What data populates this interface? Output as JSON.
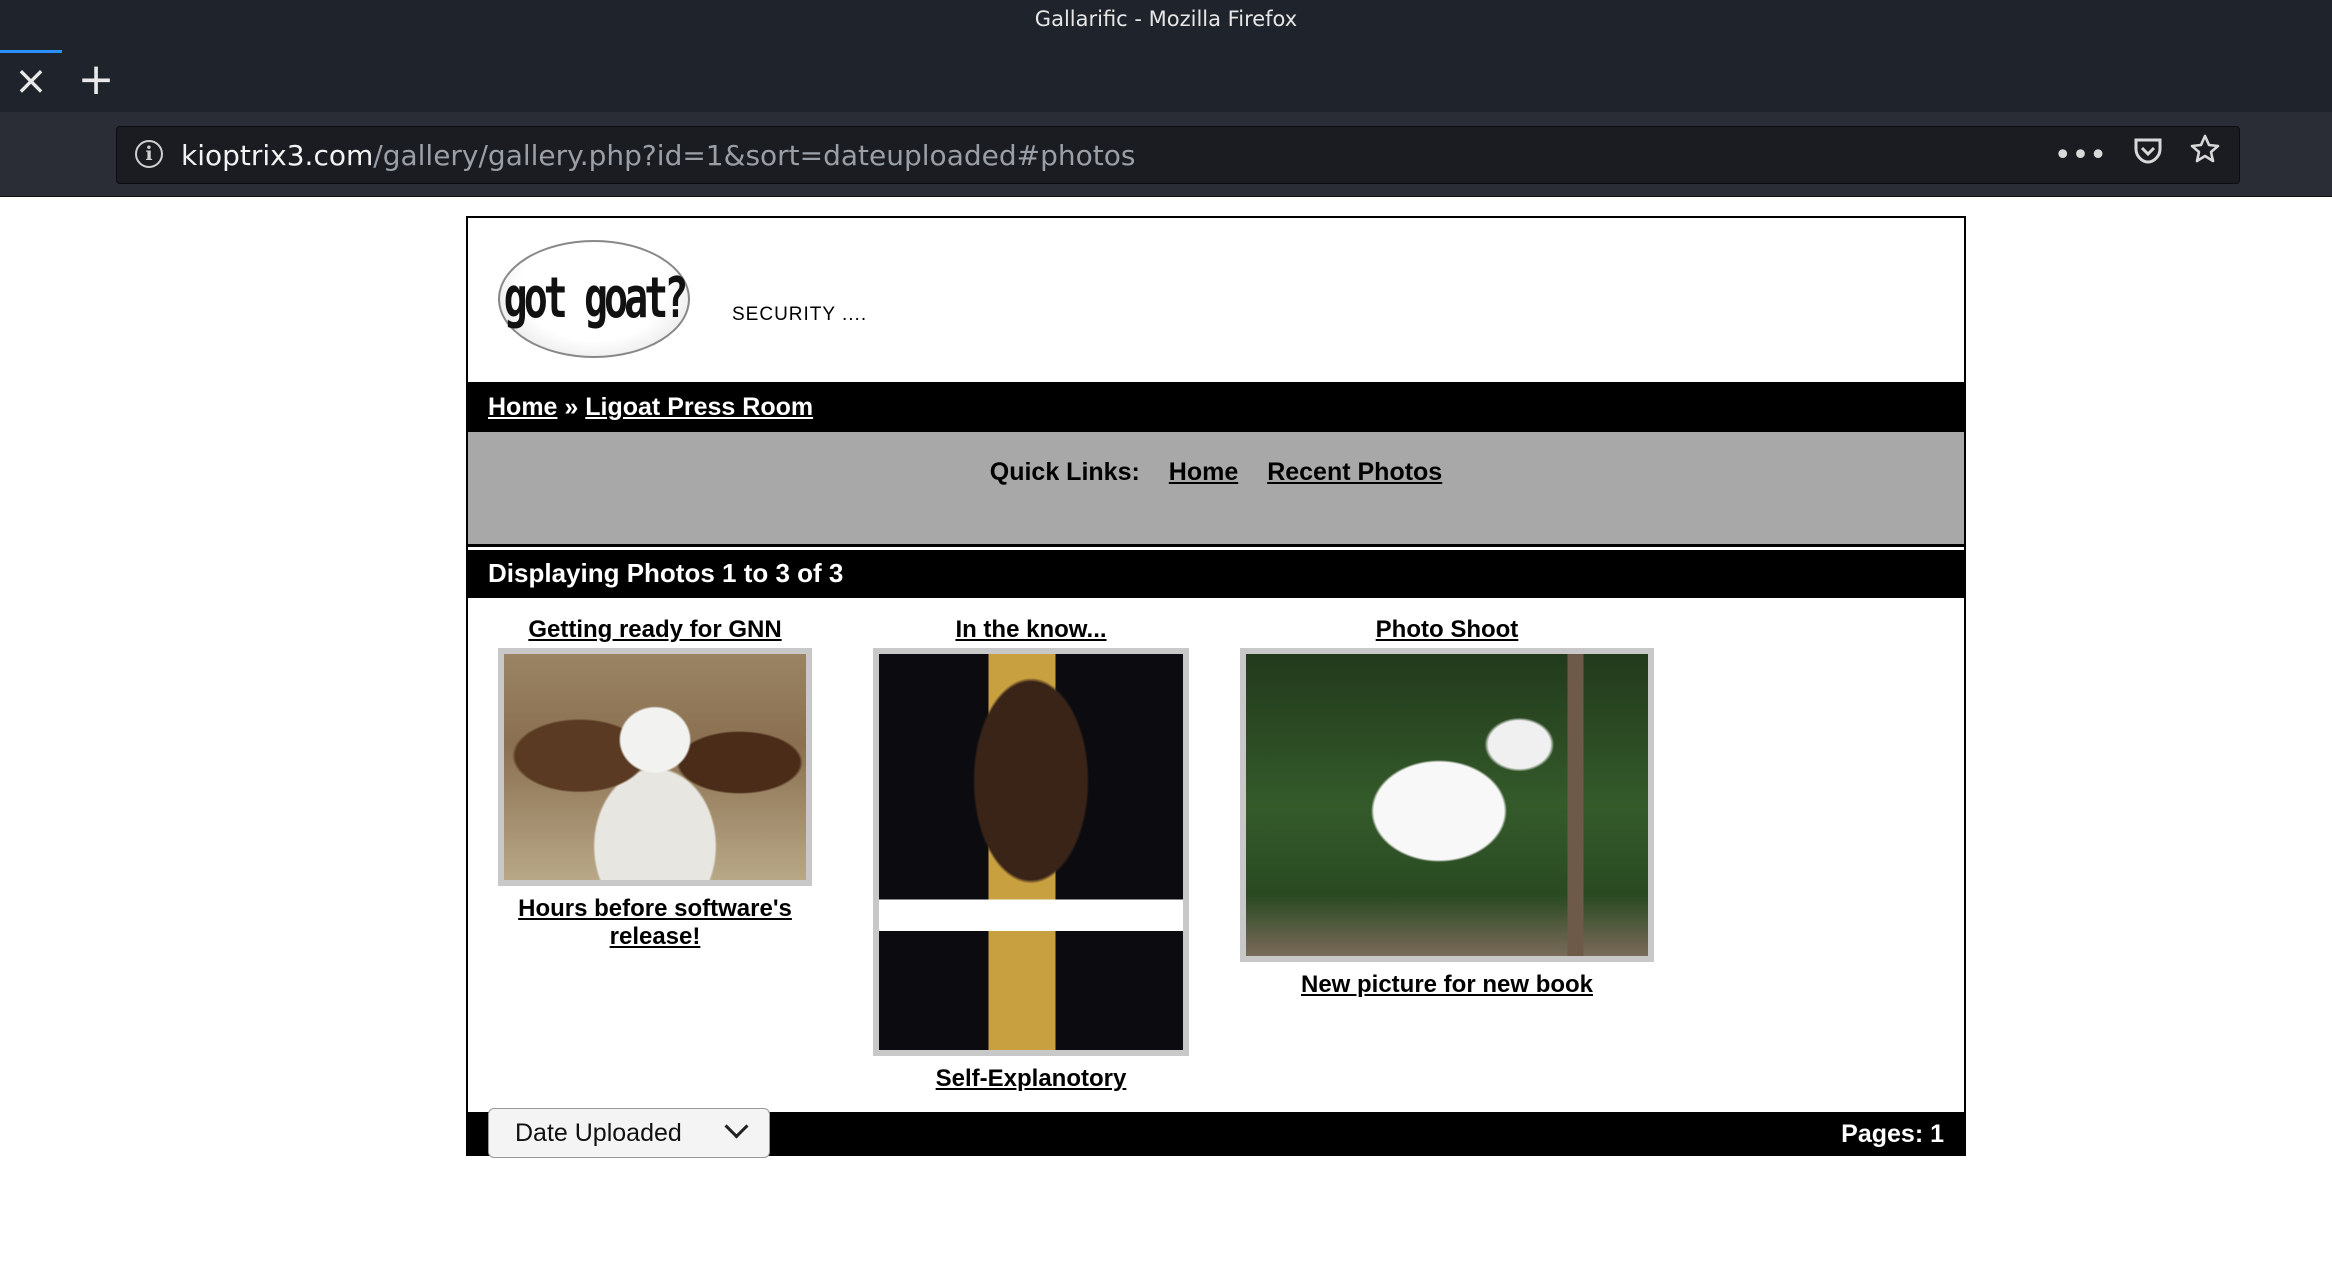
{
  "browser": {
    "window_title": "Gallarific - Mozilla Firefox",
    "tab_close_glyph": "×",
    "new_tab_glyph": "+",
    "url_host": "kioptrix3.com",
    "url_path": "/gallery/gallery.php?id=1&sort=dateuploaded#photos",
    "info_glyph": "i",
    "menu_glyph": "•••",
    "icons": [
      "info-icon",
      "page-actions-icon",
      "pocket-icon",
      "bookmark-star-icon"
    ]
  },
  "header": {
    "logo_text": "got goat?",
    "tagline": "SECURITY ...."
  },
  "breadcrumb": {
    "home": "Home",
    "separator": " » ",
    "current": "Ligoat Press Room"
  },
  "quick_links": {
    "label": "Quick Links:",
    "home": "Home",
    "recent": "Recent Photos"
  },
  "display_text": "Displaying Photos 1 to 3 of 3",
  "photos": [
    {
      "title": "Getting ready for GNN",
      "description": "Hours before software's release!"
    },
    {
      "title": "In the know...",
      "description": "Self-Explanotory"
    },
    {
      "title": "Photo Shoot",
      "description": "New picture for new book"
    }
  ],
  "footer": {
    "sort_selected": "Date Uploaded",
    "pages": "Pages: 1"
  }
}
